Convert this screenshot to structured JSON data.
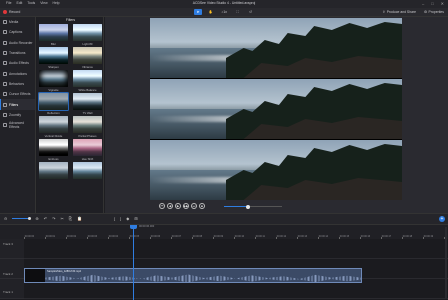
{
  "app": {
    "title": "ACDSee Video Studio 4 - Untitled.avsproj",
    "menu": [
      "File",
      "Edit",
      "Tools",
      "View",
      "Help"
    ],
    "window_controls": [
      "–",
      "□",
      "✕"
    ]
  },
  "toolbar": {
    "record_label": "Record",
    "zoom_level": "1x",
    "undo_icon": "undo-icon",
    "produce_label": "Produce and Share",
    "properties_label": "Properties"
  },
  "sidebar": {
    "items": [
      {
        "label": "Media",
        "active": false
      },
      {
        "label": "Captions",
        "active": false
      },
      {
        "label": "Audio Recorder",
        "active": false
      },
      {
        "label": "Transitions",
        "active": false
      },
      {
        "label": "Audio Effects",
        "active": false
      },
      {
        "label": "Annotations",
        "active": false
      },
      {
        "label": "Behaviors",
        "active": false
      },
      {
        "label": "Cursor Effects",
        "active": false
      },
      {
        "label": "Filters",
        "active": true
      },
      {
        "label": "Zoomify",
        "active": false
      },
      {
        "label": "Advanced Effects",
        "active": false
      }
    ]
  },
  "filters_panel": {
    "title": "Filters",
    "items": [
      {
        "label": "Blur",
        "cls": "f-blue",
        "selected": false
      },
      {
        "label": "Light 80",
        "cls": "f-wb",
        "selected": false
      },
      {
        "label": "Sharpen",
        "cls": "f-sharp",
        "selected": false
      },
      {
        "label": "Vibrance",
        "cls": "f-warm",
        "selected": false
      },
      {
        "label": "Vignette",
        "cls": "f-vig",
        "selected": false
      },
      {
        "label": "White Balance",
        "cls": "f-wb",
        "selected": false
      },
      {
        "label": "Reflection",
        "cls": "f-refl",
        "selected": true
      },
      {
        "label": "TV Wall",
        "cls": "f-tv",
        "selected": false
      },
      {
        "label": "Vertical Divide",
        "cls": "f-vs",
        "selected": false
      },
      {
        "label": "Partial Phases",
        "cls": "f-pt",
        "selected": false
      },
      {
        "label": "Emboss",
        "cls": "f-emb",
        "selected": false
      },
      {
        "label": "Hue Shift",
        "cls": "f-hs",
        "selected": false
      },
      {
        "label": "",
        "cls": "f-x1",
        "selected": false
      },
      {
        "label": "",
        "cls": "f-x2",
        "selected": false
      }
    ]
  },
  "playback": {
    "progress": 0.42,
    "buttons": [
      "⏮",
      "◀",
      "▶",
      "▶▶",
      "⏭",
      "■"
    ]
  },
  "timeline": {
    "playhead_time": "00:00:06.000",
    "ruler_labels": [
      "00:00:00",
      "00:00:01",
      "00:00:02",
      "00:00:03",
      "00:00:04",
      "00:00:05",
      "00:00:06",
      "00:00:07",
      "00:00:08",
      "00:00:09",
      "00:00:10",
      "00:00:11",
      "00:00:12",
      "00:00:13",
      "00:00:14",
      "00:00:15",
      "00:00:16",
      "00:00:17",
      "00:00:18",
      "00:00:19",
      "00:00:20"
    ],
    "tracks": [
      {
        "label": "Track 3"
      },
      {
        "label": "Track 2"
      },
      {
        "label": "Track 1"
      }
    ],
    "clip_name": "SampleVideo_1280x720.mp4"
  },
  "colors": {
    "accent": "#2f7de1",
    "record": "#e0373a"
  }
}
